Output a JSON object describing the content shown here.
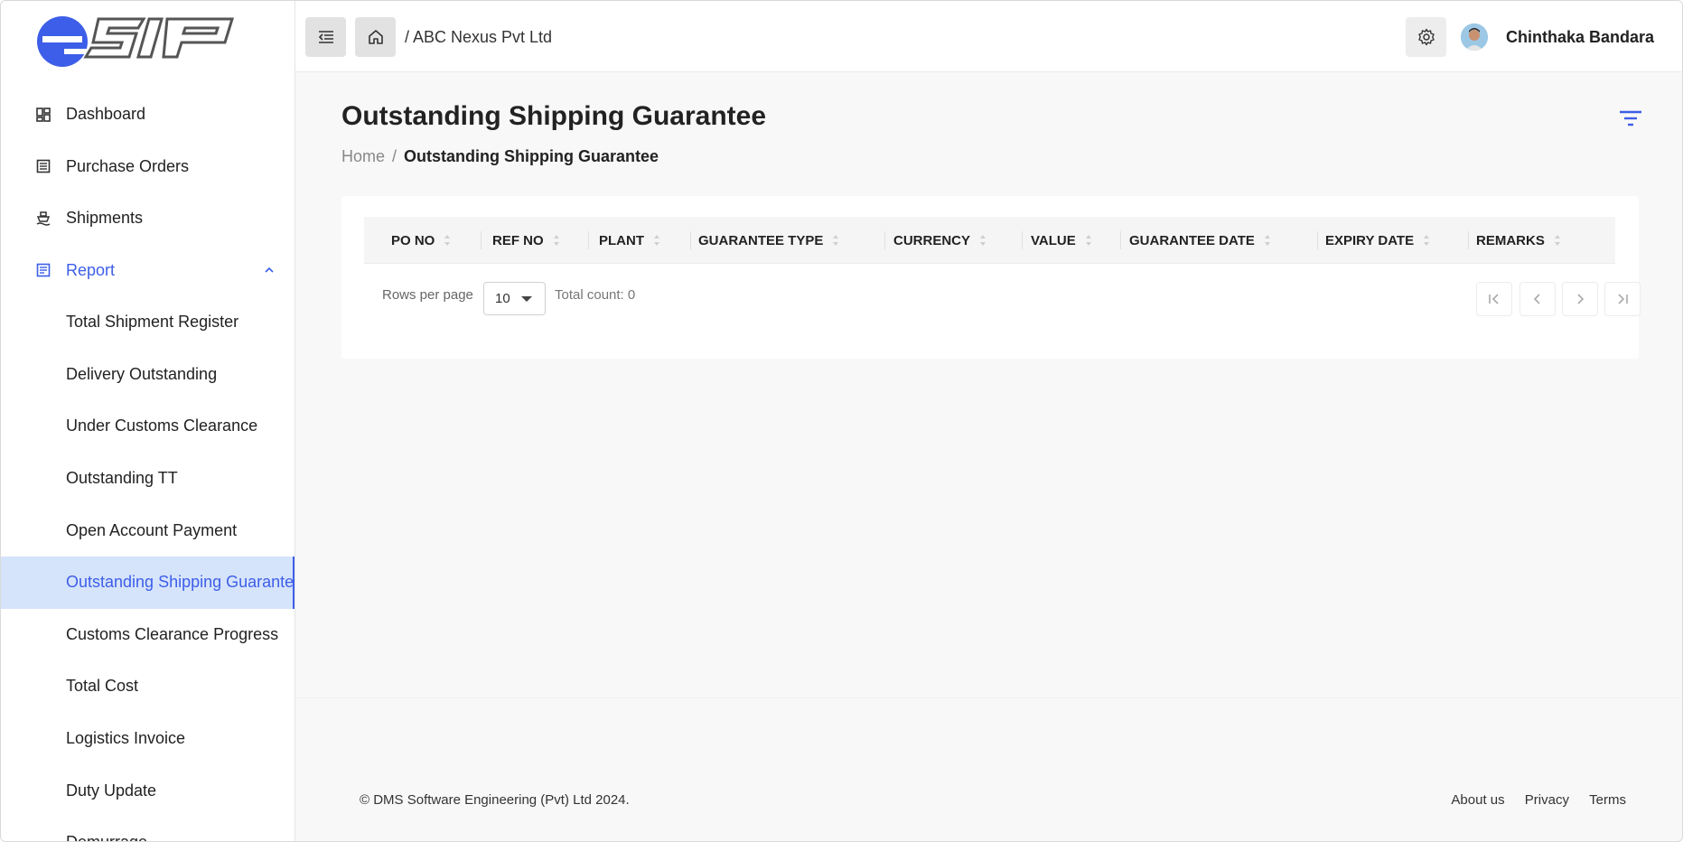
{
  "brand": {
    "logo_text": "eSIP",
    "accent": "#3d5ee8"
  },
  "sidebar": {
    "items": [
      {
        "label": "Dashboard",
        "icon": "dashboard-icon"
      },
      {
        "label": "Purchase Orders",
        "icon": "list-icon"
      },
      {
        "label": "Shipments",
        "icon": "ship-icon"
      },
      {
        "label": "Report",
        "icon": "report-icon",
        "expanded": true
      }
    ],
    "report_items": [
      "Total Shipment Register",
      "Delivery Outstanding",
      "Under Customs Clearance",
      "Outstanding TT",
      "Open Account Payment",
      "Outstanding Shipping Guarantee",
      "Customs Clearance Progress",
      "Total Cost",
      "Logistics Invoice",
      "Duty Update",
      "Demurrage"
    ],
    "active_item": "Outstanding Shipping Guarantee"
  },
  "header": {
    "breadcrumb": "/ ABC Nexus Pvt Ltd",
    "user_name": "Chinthaka Bandara"
  },
  "page": {
    "title": "Outstanding Shipping Guarantee",
    "breadcrumb_home": "Home",
    "breadcrumb_sep": "/",
    "breadcrumb_current": "Outstanding Shipping Guarantee"
  },
  "table": {
    "columns": [
      "PO NO",
      "REF NO",
      "PLANT",
      "GUARANTEE TYPE",
      "CURRENCY",
      "VALUE",
      "GUARANTEE DATE",
      "EXPIRY DATE",
      "REMARKS"
    ],
    "rows": []
  },
  "pagination": {
    "rows_per_page_label": "Rows per page",
    "rows_per_page": "10",
    "total_count": "Total count: 0"
  },
  "footer": {
    "copyright": "© DMS Software Engineering (Pvt) Ltd 2024.",
    "links": [
      "About us",
      "Privacy",
      "Terms"
    ]
  }
}
